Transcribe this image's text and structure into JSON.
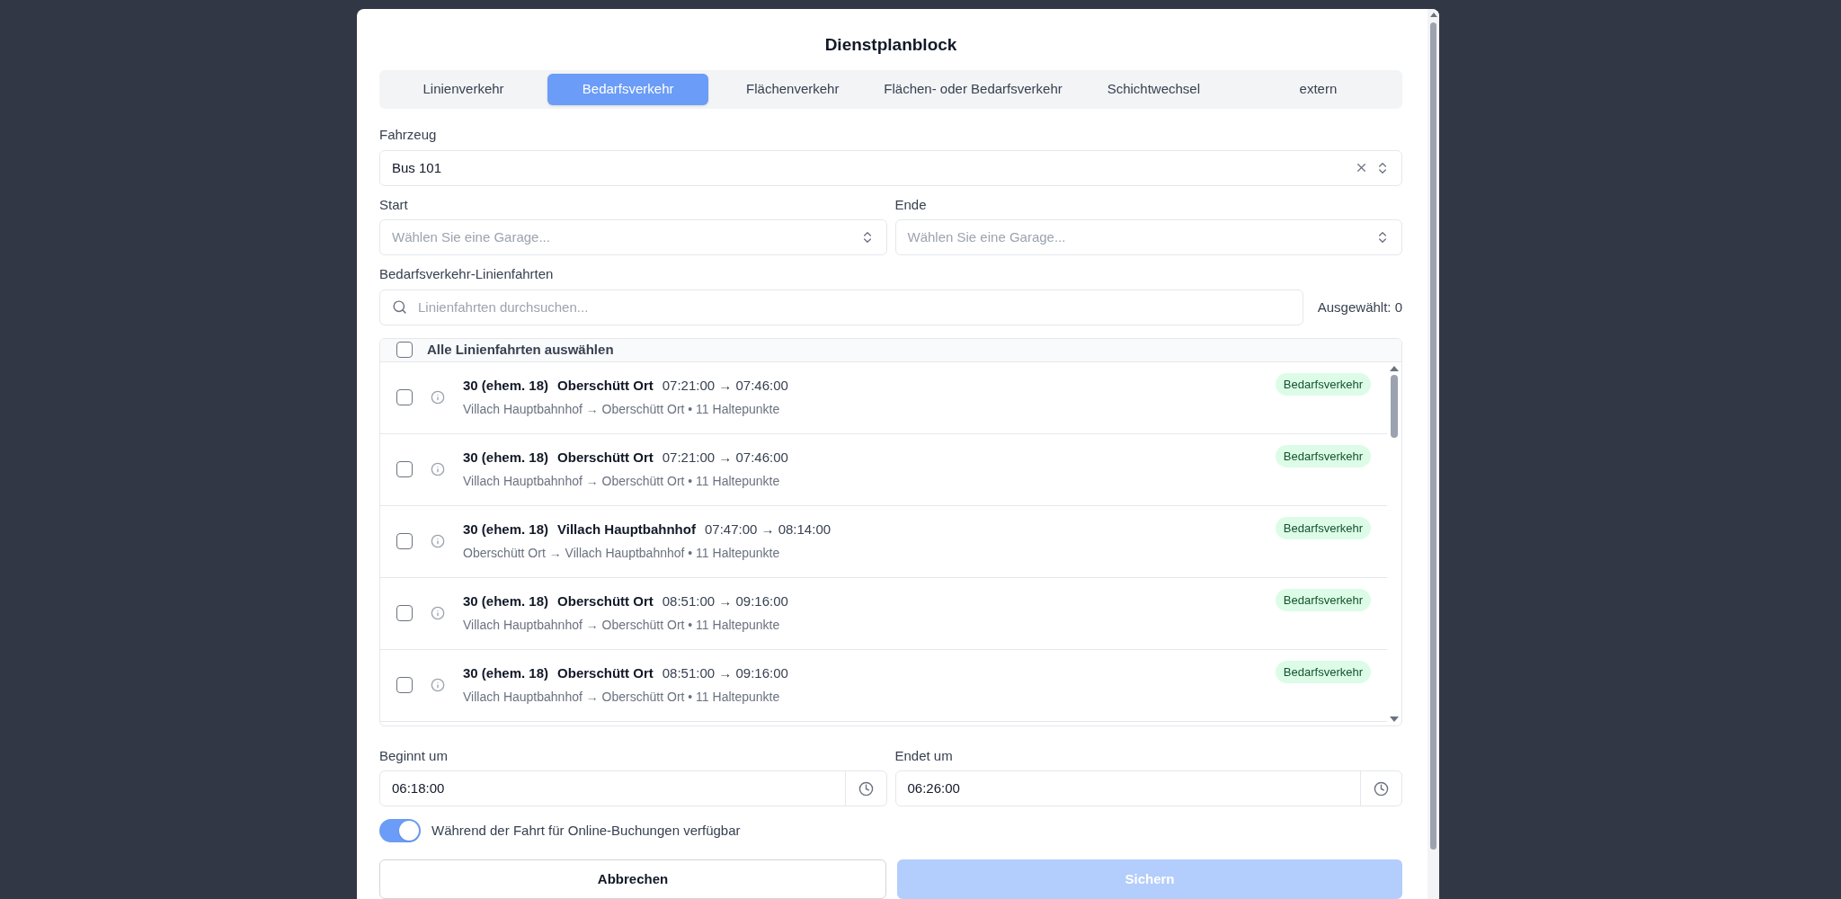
{
  "dialog": {
    "title": "Dienstplanblock"
  },
  "tabs": [
    {
      "label": "Linienverkehr",
      "selected": false
    },
    {
      "label": "Bedarfsverkehr",
      "selected": true
    },
    {
      "label": "Flächenverkehr",
      "selected": false
    },
    {
      "label": "Flächen- oder Bedarfsverkehr",
      "selected": false
    },
    {
      "label": "Schichtwechsel",
      "selected": false
    },
    {
      "label": "extern",
      "selected": false
    }
  ],
  "vehicle": {
    "label": "Fahrzeug",
    "value": "Bus 101"
  },
  "start": {
    "label": "Start",
    "placeholder": "Wählen Sie eine Garage..."
  },
  "end": {
    "label": "Ende",
    "placeholder": "Wählen Sie eine Garage..."
  },
  "trips": {
    "label": "Bedarfsverkehr-Linienfahrten",
    "placeholder": "Linienfahrten durchsuchen...",
    "selected_count": "Ausgewählt: 0",
    "select_all": {
      "label": "Alle Linienfahrten auswählen",
      "checked": false
    },
    "rows": [
      {
        "line": "30 (ehem. 18)",
        "destination": "Oberschütt Ort",
        "time": "07:21:00 → 07:46:00",
        "route": "Villach Hauptbahnhof → Oberschütt Ort • 11 Haltepunkte",
        "tag": "Bedarfsverkehr",
        "checked": false
      },
      {
        "line": "30 (ehem. 18)",
        "destination": "Oberschütt Ort",
        "time": "07:21:00 → 07:46:00",
        "route": "Villach Hauptbahnhof → Oberschütt Ort • 11 Haltepunkte",
        "tag": "Bedarfsverkehr",
        "checked": false
      },
      {
        "line": "30 (ehem. 18)",
        "destination": "Villach Hauptbahnhof",
        "time": "07:47:00 → 08:14:00",
        "route": "Oberschütt Ort → Villach Hauptbahnhof • 11 Haltepunkte",
        "tag": "Bedarfsverkehr",
        "checked": false
      },
      {
        "line": "30 (ehem. 18)",
        "destination": "Oberschütt Ort",
        "time": "08:51:00 → 09:16:00",
        "route": "Villach Hauptbahnhof → Oberschütt Ort • 11 Haltepunkte",
        "tag": "Bedarfsverkehr",
        "checked": false
      },
      {
        "line": "30 (ehem. 18)",
        "destination": "Oberschütt Ort",
        "time": "08:51:00 → 09:16:00",
        "route": "Villach Hauptbahnhof → Oberschütt Ort • 11 Haltepunkte",
        "tag": "Bedarfsverkehr",
        "checked": false
      }
    ]
  },
  "begins": {
    "label": "Beginnt um",
    "value": "06:18:00"
  },
  "ends": {
    "label": "Endet um",
    "value": "06:26:00"
  },
  "online_booking": {
    "label": "Während der Fahrt für Online-Buchungen verfügbar",
    "on": true
  },
  "buttons": [
    {
      "label": "Abbrechen",
      "kind": "secondary",
      "disabled": false
    },
    {
      "label": "Sichern",
      "kind": "primary",
      "disabled": true
    }
  ]
}
